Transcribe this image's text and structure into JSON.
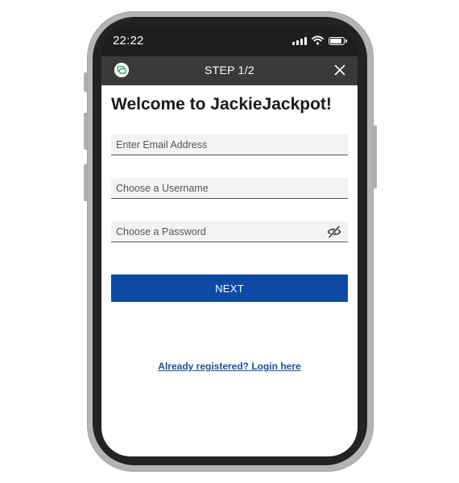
{
  "status_bar": {
    "time": "22:22",
    "icons": [
      "cellular-signal-icon",
      "wifi-icon",
      "battery-icon"
    ]
  },
  "header": {
    "icon": "chat-support-icon",
    "title": "STEP 1/2",
    "close_icon": "close-icon"
  },
  "form": {
    "title": "Welcome to JackieJackpot!",
    "email_placeholder": "Enter Email Address",
    "username_placeholder": "Choose a Username",
    "password_placeholder": "Choose a Password",
    "password_toggle_icon": "eye-slash-icon",
    "next_label": "NEXT",
    "login_link": "Already registered? Login here"
  },
  "colors": {
    "primary_button": "#0d4aa3",
    "header_bg": "#3a3a3a",
    "chat_icon": "#3aaa5a",
    "link": "#1b4f9b",
    "field_bg": "#f3f3f3"
  }
}
